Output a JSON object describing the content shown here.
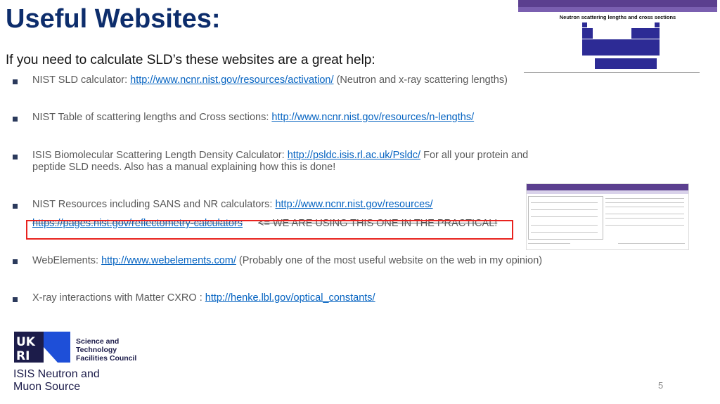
{
  "slide": {
    "title": "Useful Websites:",
    "intro": "If you need to calculate SLD’s these websites are a great help:",
    "page_number": "5"
  },
  "items": [
    {
      "prefix": "NIST SLD calculator: ",
      "link": "http://www.ncnr.nist.gov/resources/activation/",
      "suffix": "  (Neutron and x-ray scattering lengths)"
    },
    {
      "prefix": "NIST Table of scattering lengths and Cross sections: ",
      "link": "http://www.ncnr.nist.gov/resources/n-lengths/",
      "suffix": ""
    },
    {
      "prefix": "ISIS Biomolecular Scattering Length Density Calculator: ",
      "link": "http://psldc.isis.rl.ac.uk/Psldc/",
      "suffix": "  For all your protein and",
      "line2": "peptide SLD needs. Also has a manual explaining how this is done!"
    },
    {
      "prefix": "NIST Resources including SANS and NR calculators:  ",
      "link": "http://www.ncnr.nist.gov/resources/",
      "suffix": ""
    },
    {
      "prefix": "WebElements: ",
      "link": "http://www.webelements.com/",
      "suffix": "   (Probably one of the most useful website on the web in my opinion)"
    },
    {
      "prefix": "X-ray interactions with Matter CXRO : ",
      "link": "http://henke.lbl.gov/optical_constants/",
      "suffix": ""
    }
  ],
  "highlight": {
    "link": "https://pages.nist.gov/reflectometry-calculators",
    "note": "<= WE ARE USING THIS ONE IN THE PRACTICAL!"
  },
  "thumbnails": {
    "table_title": "Neutron scattering lengths and cross sections"
  },
  "logo": {
    "stfc_line1": "Science and",
    "stfc_line2": "Technology",
    "stfc_line3": "Facilities Council",
    "isis_line1": "ISIS Neutron and",
    "isis_line2": "Muon Source"
  },
  "colors": {
    "title": "#0d2d6c",
    "link": "#0563c1",
    "highlight_border": "#e8231f",
    "ukri_blue": "#1e4fd8"
  }
}
